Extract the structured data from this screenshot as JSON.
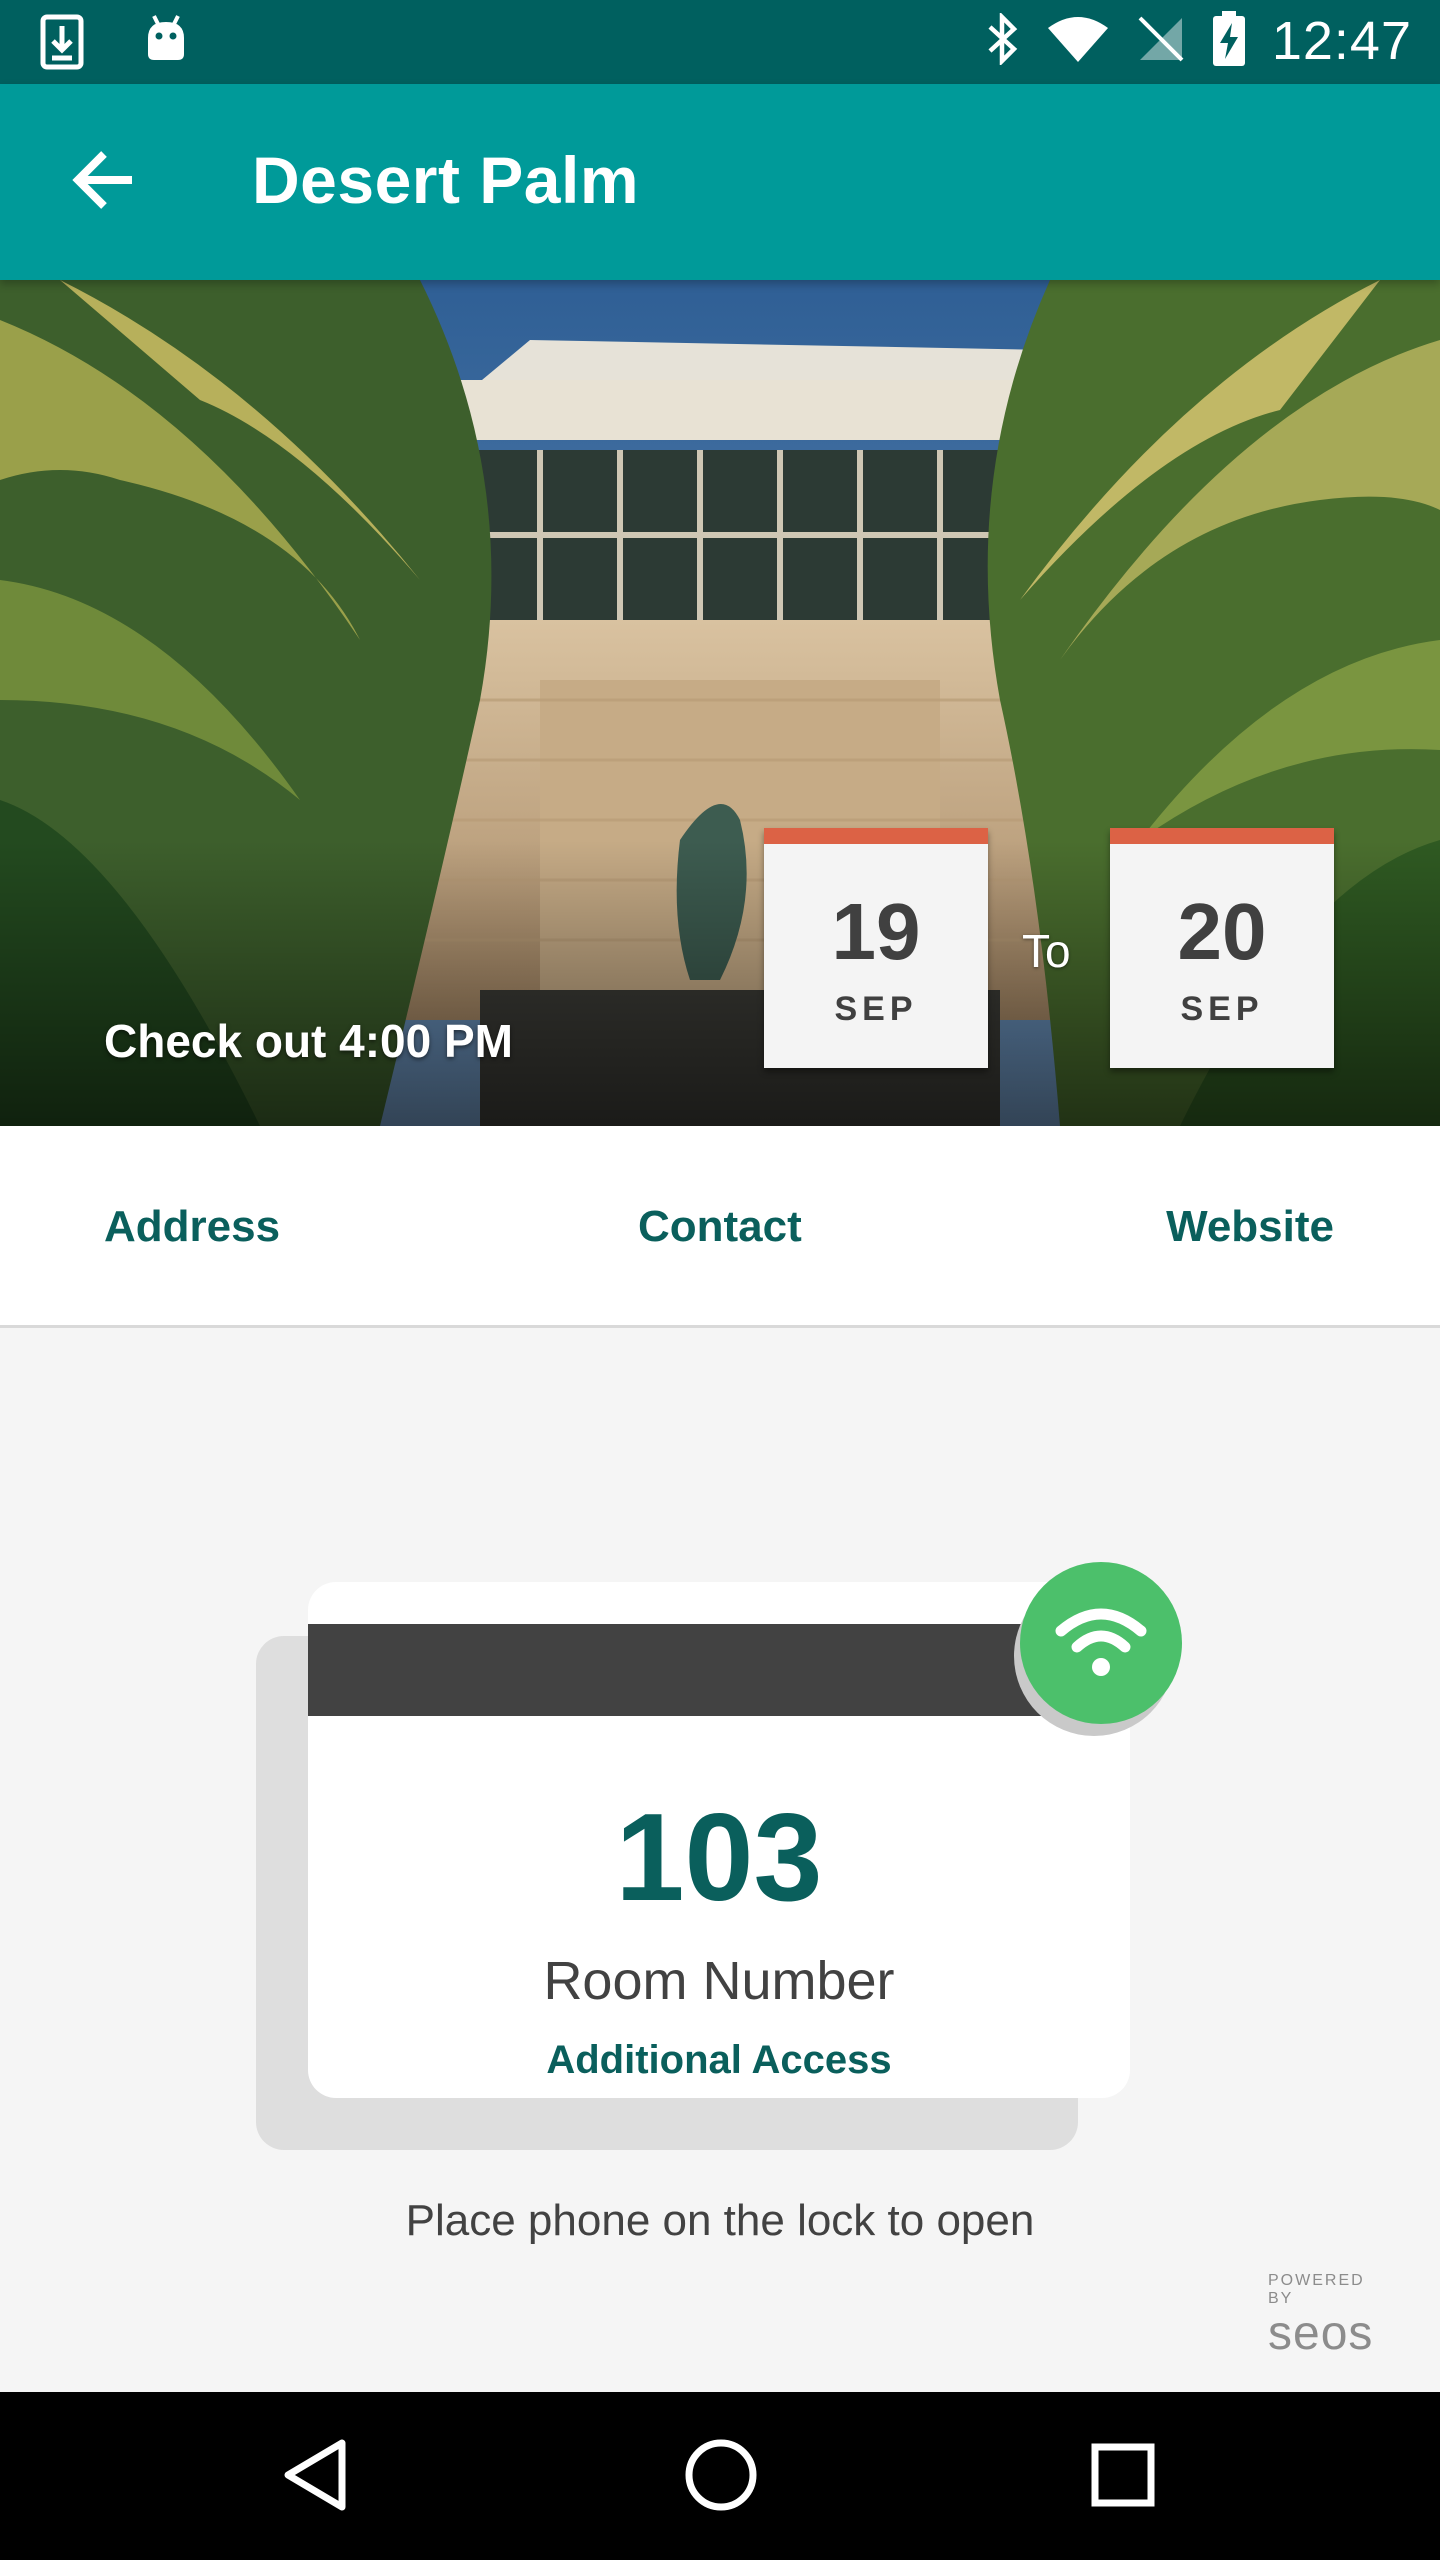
{
  "status_bar": {
    "time": "12:47",
    "left_icons": [
      "download-icon",
      "android-icon"
    ],
    "right_icons": [
      "bluetooth-icon",
      "wifi-icon",
      "no-sim-icon",
      "battery-charging-icon"
    ]
  },
  "app_bar": {
    "title": "Desert Palm",
    "back_icon": "arrow-back-icon"
  },
  "hero": {
    "checkout": "Check out 4:00 PM",
    "from": {
      "day": "19",
      "month": "SEP"
    },
    "to_label": "To",
    "to": {
      "day": "20",
      "month": "SEP"
    }
  },
  "links": {
    "address": "Address",
    "contact": "Contact",
    "website": "Website"
  },
  "key": {
    "room_number": "103",
    "room_label": "Room Number",
    "additional_access": "Additional Access",
    "nfc_icon": "wireless-icon",
    "hint": "Place phone on the lock to open"
  },
  "branding": {
    "powered_by": "POWERED BY",
    "name": "seos"
  },
  "colors": {
    "status_bar": "#00605f",
    "app_bar": "#009a99",
    "accent_text": "#0a5f5c",
    "date_top": "#dc6245",
    "nfc_green": "#4cc06b"
  },
  "nav_bar": {
    "icons": [
      "nav-back-icon",
      "nav-home-icon",
      "nav-recents-icon"
    ]
  }
}
